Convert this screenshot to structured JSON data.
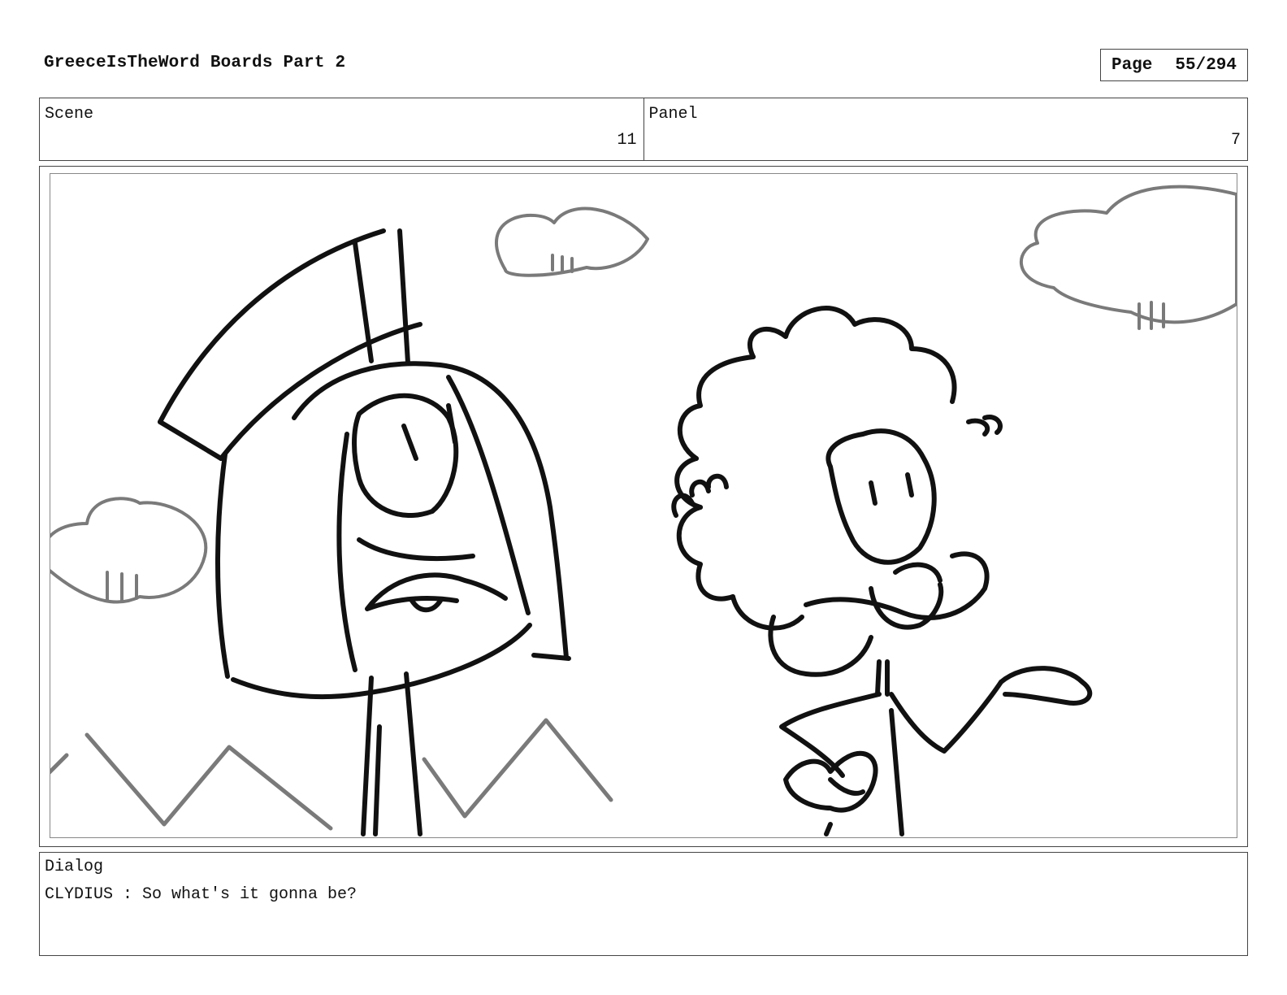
{
  "header": {
    "title": "GreeceIsTheWord Boards Part 2",
    "page_label": "Page",
    "page_value": "55/294"
  },
  "info": {
    "scene_label": "Scene",
    "scene_value": "11",
    "panel_label": "Panel",
    "panel_value": "7"
  },
  "dialog": {
    "label": "Dialog",
    "text": "CLYDIUS : So what's it gonna be?"
  }
}
